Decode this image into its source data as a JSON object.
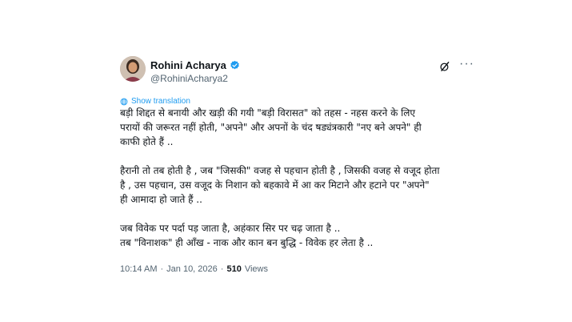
{
  "author": {
    "display_name": "Rohini Acharya",
    "handle": "@RohiniAcharya2",
    "verified_badge_icon": "verified-check-icon",
    "badge_color": "#1d9bf0"
  },
  "actions": {
    "grok_icon": "grok-slash-icon",
    "more_icon": "more-horizontal-icon",
    "more_label": "···"
  },
  "translate": {
    "icon": "globe-icon",
    "label": "Show translation",
    "color": "#1d9bf0"
  },
  "tweet": {
    "paragraphs": [
      "बड़ी शिद्दत से बनायी और खड़ी की गयी \"बड़ी विरासत\" को तहस - नहस करने के लिए\nपरायों की जरूरत नहीं होती, \"अपने\" और अपनों के चंद षड्यंत्रकारी \"नए बने अपने\" ही\nकाफी होते हैं ..",
      "हैरानी तो तब होती है , जब \"जिसकी\" वजह से पहचान होती है , जिसकी वजह से वजूद होता\nहै , उस पहचान, उस वजूद के निशान को बहकावे में आ कर मिटाने और हटाने पर \"अपने\"\nही आमादा हो जाते हैं ..",
      "जब विवेक पर पर्दा पड़ जाता है, अहंकार सिर पर चढ़ जाता है ..\nतब \"विनाशक\" ही आँख - नाक और कान बन बुद्धि - विवेक हर लेता है .."
    ]
  },
  "meta": {
    "time": "10:14 AM",
    "separator": "·",
    "date": "Jan 10, 2026",
    "views_count": "510",
    "views_label": "Views"
  }
}
